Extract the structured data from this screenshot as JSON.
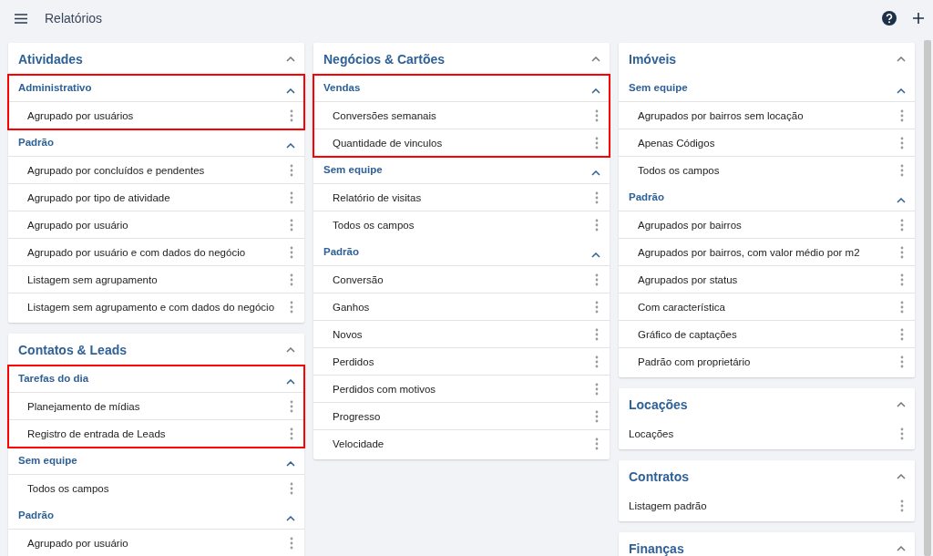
{
  "header": {
    "title": "Relatórios"
  },
  "columns": [
    {
      "cards": [
        {
          "title": "Atividades",
          "expanded": true,
          "groups": [
            {
              "title": "Administrativo",
              "expanded": true,
              "highlighted": true,
              "items": [
                "Agrupado por usuários"
              ]
            },
            {
              "title": "Padrão",
              "expanded": true,
              "highlighted": false,
              "items": [
                "Agrupado por concluídos e pendentes",
                "Agrupado por tipo de atividade",
                "Agrupado por usuário",
                "Agrupado por usuário e com dados do negócio",
                "Listagem sem agrupamento",
                "Listagem sem agrupamento e com dados do negócio"
              ]
            }
          ]
        },
        {
          "title": "Contatos & Leads",
          "expanded": true,
          "groups": [
            {
              "title": "Tarefas do dia",
              "expanded": true,
              "highlighted": true,
              "items": [
                "Planejamento de mídias",
                "Registro de entrada de Leads"
              ]
            },
            {
              "title": "Sem equipe",
              "expanded": true,
              "highlighted": false,
              "items": [
                "Todos os campos"
              ]
            },
            {
              "title": "Padrão",
              "expanded": true,
              "highlighted": false,
              "items": [
                "Agrupado por usuário"
              ]
            }
          ]
        }
      ]
    },
    {
      "cards": [
        {
          "title": "Negócios & Cartões",
          "expanded": true,
          "groups": [
            {
              "title": "Vendas",
              "expanded": true,
              "highlighted": true,
              "items": [
                "Conversões semanais",
                "Quantidade de vinculos"
              ]
            },
            {
              "title": "Sem equipe",
              "expanded": true,
              "highlighted": false,
              "items": [
                "Relatório de visitas",
                "Todos os campos"
              ]
            },
            {
              "title": "Padrão",
              "expanded": true,
              "highlighted": false,
              "items": [
                "Conversão",
                "Ganhos",
                "Novos",
                "Perdidos",
                "Perdidos com motivos",
                "Progresso",
                "Velocidade"
              ]
            }
          ]
        }
      ]
    },
    {
      "cards": [
        {
          "title": "Imóveis",
          "expanded": true,
          "groups": [
            {
              "title": "Sem equipe",
              "expanded": true,
              "highlighted": false,
              "items": [
                "Agrupados por bairros sem locação",
                "Apenas Códigos",
                "Todos os campos"
              ]
            },
            {
              "title": "Padrão",
              "expanded": true,
              "highlighted": false,
              "items": [
                "Agrupados por bairros",
                "Agrupados por bairros, com valor médio por m2",
                "Agrupados por status",
                "Com característica",
                "Gráfico de captações",
                "Padrão com proprietário"
              ]
            }
          ]
        },
        {
          "title": "Locações",
          "expanded": true,
          "items": [
            "Locações"
          ]
        },
        {
          "title": "Contratos",
          "expanded": true,
          "items": [
            "Listagem padrão"
          ]
        },
        {
          "title": "Finanças",
          "expanded": true
        }
      ]
    }
  ]
}
